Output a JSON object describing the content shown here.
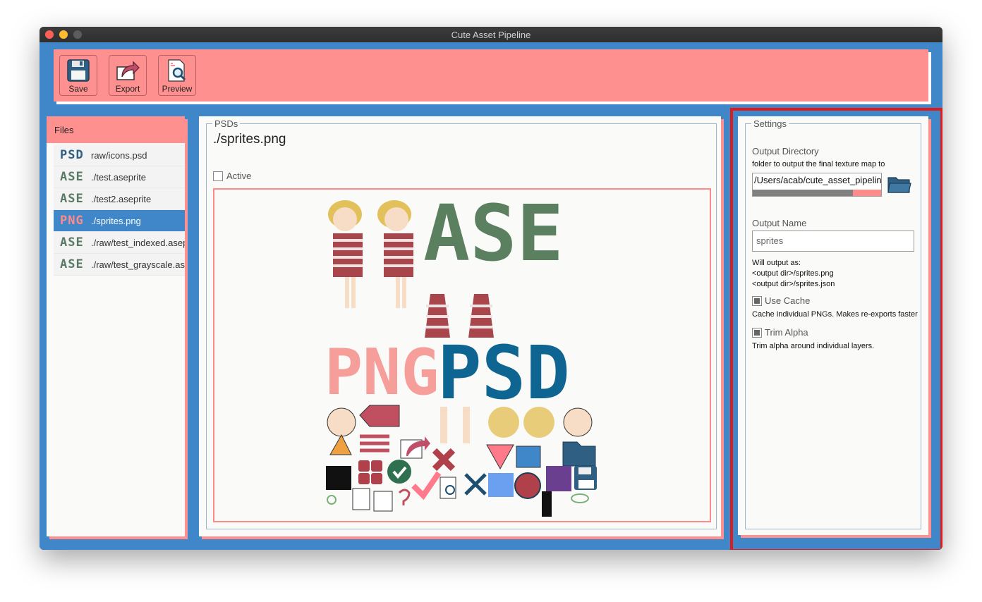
{
  "window": {
    "title": "Cute Asset Pipeline"
  },
  "toolbar": {
    "save_label": "Save",
    "export_label": "Export",
    "preview_label": "Preview"
  },
  "files": {
    "header": "Files",
    "items": [
      {
        "badge": "PSD",
        "name": "raw/icons.psd"
      },
      {
        "badge": "ASE",
        "name": "./test.aseprite"
      },
      {
        "badge": "ASE",
        "name": "./test2.aseprite"
      },
      {
        "badge": "PNG",
        "name": "./sprites.png"
      },
      {
        "badge": "ASE",
        "name": "./raw/test_indexed.aseprite"
      },
      {
        "badge": "ASE",
        "name": "./raw/test_grayscale.aseprite"
      }
    ]
  },
  "psds": {
    "group_title": "PSDs",
    "file_title": "./sprites.png",
    "active_label": "Active",
    "preview_text": {
      "ase": "ASE",
      "png": "PNG",
      "psd": "PSD"
    }
  },
  "settings": {
    "group_title": "Settings",
    "output_dir_label": "Output Directory",
    "output_dir_desc": "folder to output the final texture map to",
    "output_dir_value": "/Users/acab/cute_asset_pipeline",
    "output_name_label": "Output Name",
    "output_name_value": "sprites",
    "will_output_as": "Will output as:",
    "out_png": "<output dir>/sprites.png",
    "out_json": "<output dir>/sprites.json",
    "use_cache_label": "Use Cache",
    "use_cache_desc": "Cache individual PNGs. Makes re-exports faster",
    "trim_alpha_label": "Trim Alpha",
    "trim_alpha_desc": "Trim alpha around individual layers."
  },
  "colors": {
    "accent": "#ff9090",
    "blue": "#3f87c8",
    "highlight": "#e11b1b"
  }
}
